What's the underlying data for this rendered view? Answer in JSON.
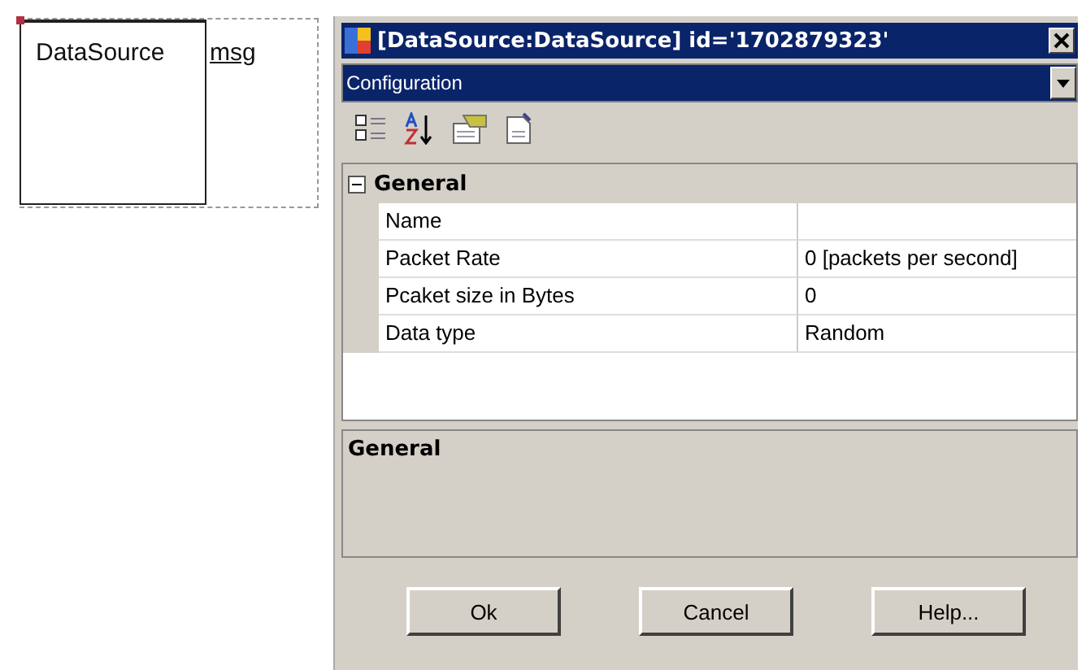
{
  "canvas": {
    "node": {
      "label": "DataSource",
      "port": "msg"
    }
  },
  "dialog": {
    "title": "[DataSource:DataSource] id='1702879323'",
    "dropdown": {
      "value": "Configuration"
    },
    "grid": {
      "category": {
        "label": "General",
        "expanded": true
      },
      "properties": [
        {
          "name": "Name"
        },
        {
          "name": "Packet Rate",
          "value": "0 [packets per second]"
        },
        {
          "name": "Pcaket size in Bytes",
          "value": "0"
        },
        {
          "name": "Data type",
          "value": "Random"
        }
      ]
    },
    "description": {
      "title": "General"
    },
    "buttons": [
      "Ok",
      "Cancel",
      "Help..."
    ]
  }
}
